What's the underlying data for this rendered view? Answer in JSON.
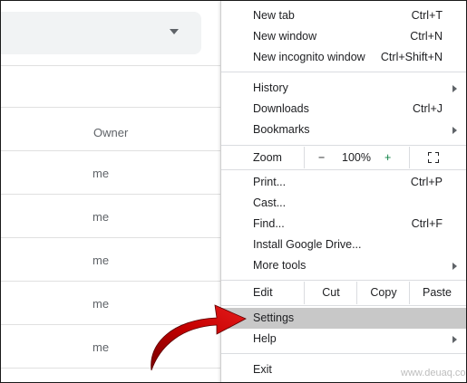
{
  "background": {
    "owner_header": "Owner",
    "owner_cells": [
      "me",
      "me",
      "me",
      "me",
      "me"
    ]
  },
  "menu": {
    "new_tab": {
      "label": "New tab",
      "shortcut": "Ctrl+T"
    },
    "new_window": {
      "label": "New window",
      "shortcut": "Ctrl+N"
    },
    "new_incognito": {
      "label": "New incognito window",
      "shortcut": "Ctrl+Shift+N"
    },
    "history": {
      "label": "History"
    },
    "downloads": {
      "label": "Downloads",
      "shortcut": "Ctrl+J"
    },
    "bookmarks": {
      "label": "Bookmarks"
    },
    "zoom": {
      "label": "Zoom",
      "minus": "−",
      "level": "100%",
      "plus": "+"
    },
    "print": {
      "label": "Print...",
      "shortcut": "Ctrl+P"
    },
    "cast": {
      "label": "Cast..."
    },
    "find": {
      "label": "Find...",
      "shortcut": "Ctrl+F"
    },
    "install": {
      "label": "Install Google Drive..."
    },
    "more_tools": {
      "label": "More tools"
    },
    "edit": {
      "label": "Edit",
      "cut": "Cut",
      "copy": "Copy",
      "paste": "Paste"
    },
    "settings": {
      "label": "Settings"
    },
    "help": {
      "label": "Help"
    },
    "exit": {
      "label": "Exit"
    }
  },
  "colors": {
    "highlight": "#c8c8c8",
    "arrow": "#c40000"
  },
  "watermark": "www.deuaq.com"
}
